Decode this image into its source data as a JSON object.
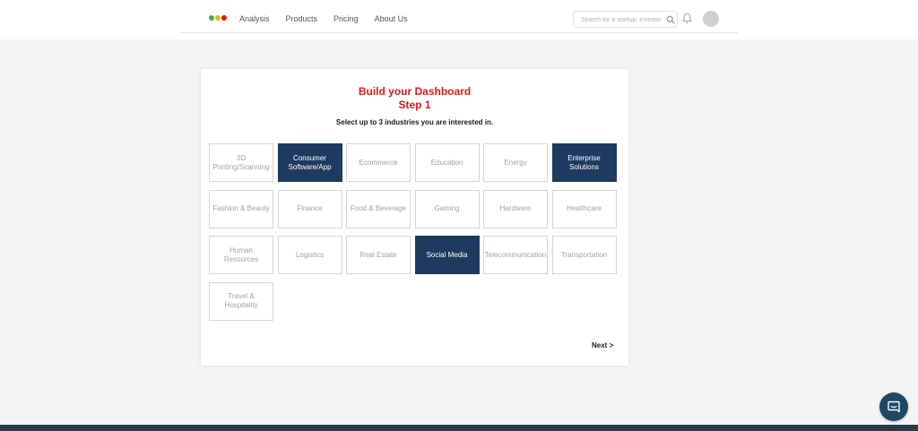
{
  "colors": {
    "logo_dots": [
      "#3cb043",
      "#f2b705",
      "#d81b1b"
    ],
    "accent_red": "#d81b1b",
    "selected_tile": "#1f3a5f"
  },
  "nav": {
    "items": [
      "Analysis",
      "Products",
      "Pricing",
      "About Us"
    ]
  },
  "search": {
    "placeholder": "Search for a startup, investor",
    "icon": "search-icon"
  },
  "icons": {
    "notifications": "bell-icon",
    "chat": "chat-icon"
  },
  "main": {
    "title": "Build your Dashboard",
    "step": "Step 1",
    "subtitle": "Select up to 3 industries you are interested in.",
    "industries": [
      {
        "label": "3D\nPrinting/Scanning",
        "selected": false
      },
      {
        "label": "Consumer\nSoftware/App",
        "selected": true
      },
      {
        "label": "Ecommerce",
        "selected": false
      },
      {
        "label": "Education",
        "selected": false
      },
      {
        "label": "Energy",
        "selected": false
      },
      {
        "label": "Enterprise\nSolutions",
        "selected": true
      },
      {
        "label": "Fashion & Beauty",
        "selected": false
      },
      {
        "label": "Finance",
        "selected": false
      },
      {
        "label": "Food & Beverage",
        "selected": false
      },
      {
        "label": "Gaming",
        "selected": false
      },
      {
        "label": "Hardware",
        "selected": false
      },
      {
        "label": "Healthcare",
        "selected": false
      },
      {
        "label": "Human\nResources",
        "selected": false
      },
      {
        "label": "Logistics",
        "selected": false
      },
      {
        "label": "Real Estate",
        "selected": false
      },
      {
        "label": "Social Media",
        "selected": true
      },
      {
        "label": "Telecommunication",
        "selected": false
      },
      {
        "label": "Transportation",
        "selected": false
      },
      {
        "label": "Travel &\nHospitality",
        "selected": false
      }
    ],
    "next_label": "Next >"
  }
}
